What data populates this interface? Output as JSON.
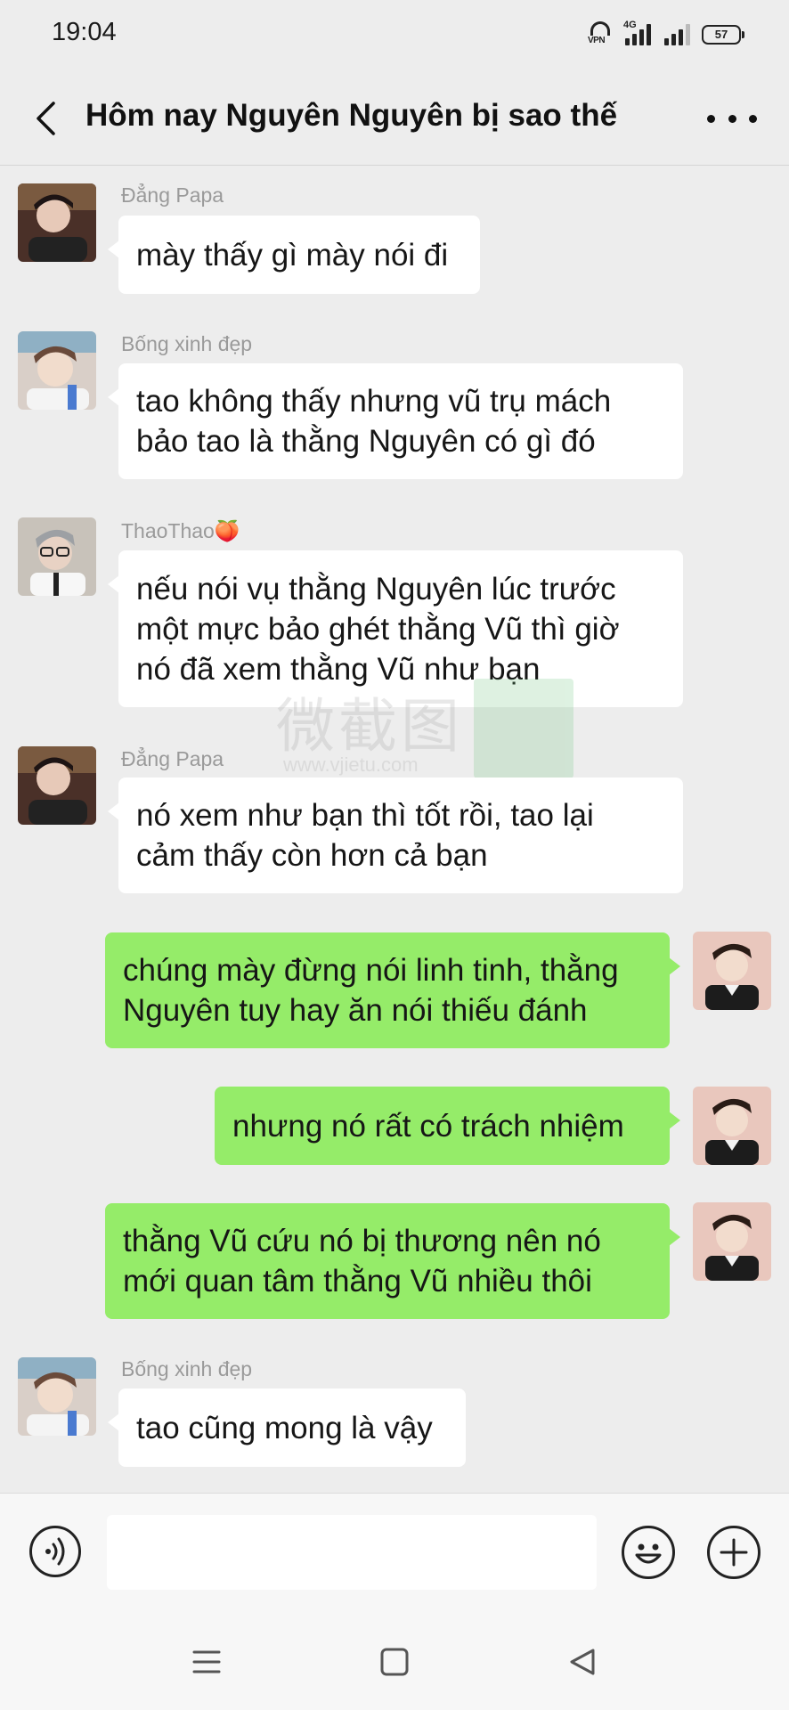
{
  "status_bar": {
    "time": "19:04",
    "vpn_label": "VPN",
    "network_label": "4G",
    "battery_level": "57"
  },
  "header": {
    "title": "Hôm nay Nguyên Nguyên bị sao thế",
    "back_icon": "chevron-left-icon",
    "more_icon": "more-dots-icon"
  },
  "messages": [
    {
      "sender": "Đẳng Papa",
      "direction": "in",
      "text": "mày thấy gì mày nói đi"
    },
    {
      "sender": "Bống xinh đẹp",
      "direction": "in",
      "text": "tao không thấy nhưng vũ trụ mách\nbảo tao là thằng Nguyên có gì đó"
    },
    {
      "sender": "ThaoThao🍑",
      "direction": "in",
      "text": "nếu nói vụ thằng Nguyên lúc trước\nmột mực bảo ghét thằng Vũ thì giờ\nnó đã xem thằng Vũ như bạn"
    },
    {
      "sender": "Đẳng Papa",
      "direction": "in",
      "text": "nó xem như bạn thì tốt rồi, tao lại\ncảm thấy còn hơn cả bạn"
    },
    {
      "sender": "",
      "direction": "out",
      "text": "chúng mày đừng nói linh tinh, thằng\nNguyên tuy hay ăn nói thiếu đánh"
    },
    {
      "sender": "",
      "direction": "out",
      "text": "nhưng nó rất có trách nhiệm"
    },
    {
      "sender": "",
      "direction": "out",
      "text": "thằng Vũ cứu nó bị thương nên nó\nmới quan tâm thằng Vũ nhiều thôi"
    },
    {
      "sender": "Bống xinh đẹp",
      "direction": "in",
      "text": "tao cũng mong là vậy"
    }
  ],
  "watermark": {
    "text": "微截图",
    "url": "www.vjietu.com"
  },
  "input_bar": {
    "message_value": "",
    "voice_icon": "voice-icon",
    "emoji_icon": "emoji-icon",
    "plus_icon": "plus-icon"
  },
  "nav_bar": {
    "icons": [
      "menu-icon",
      "home-square-icon",
      "back-triangle-icon"
    ]
  },
  "colors": {
    "background": "#ededed",
    "incoming_bubble": "#ffffff",
    "outgoing_bubble": "#95ec69",
    "sender_name": "#9a9a9a"
  }
}
